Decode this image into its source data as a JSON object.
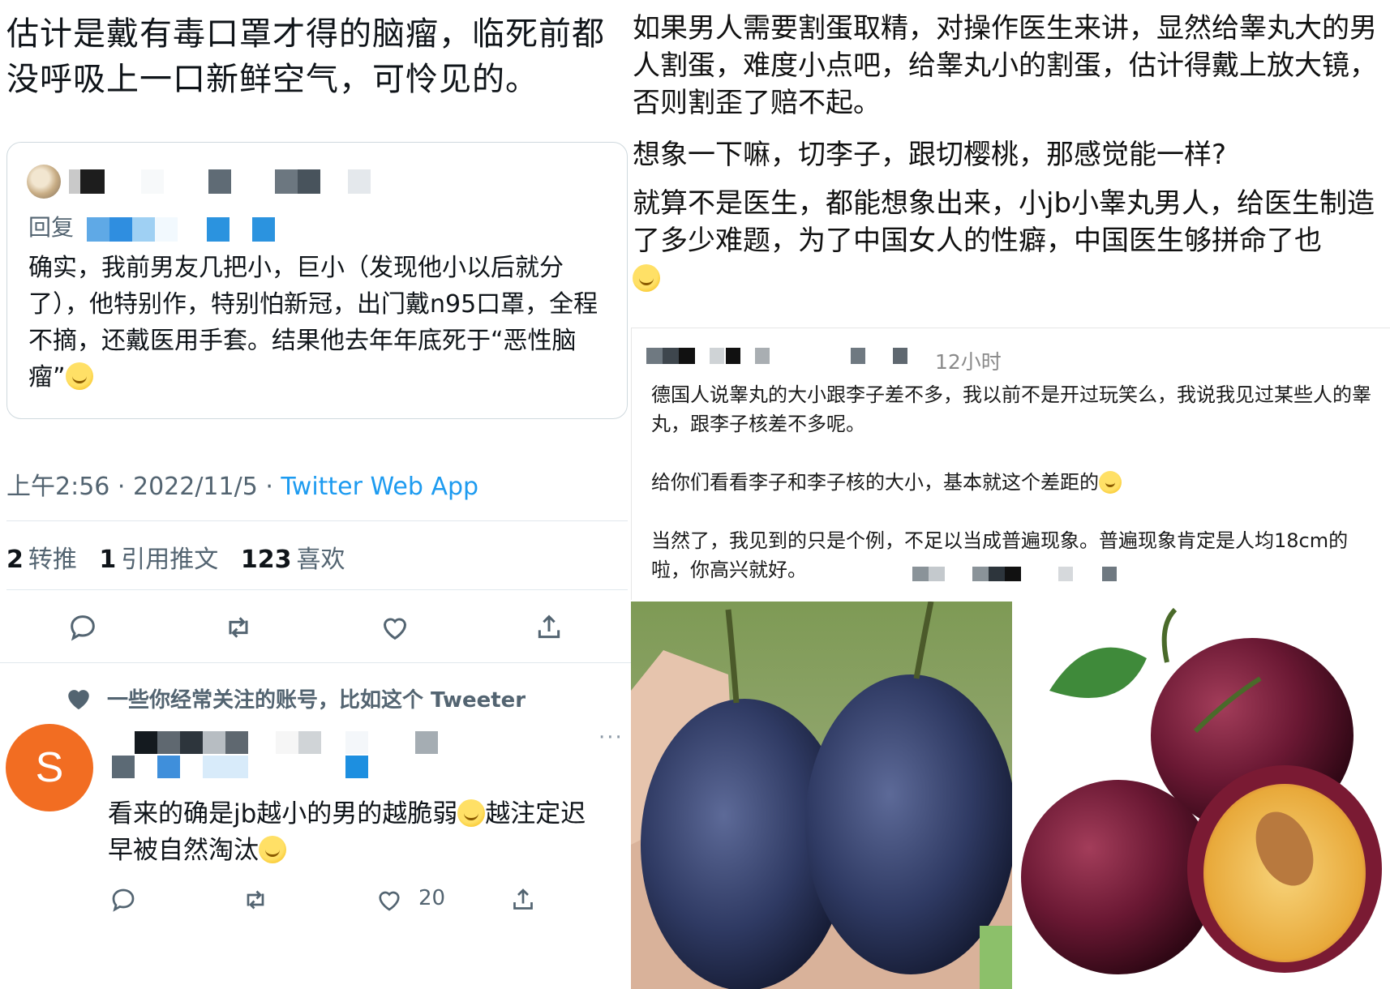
{
  "tweet": {
    "text": "估计是戴有毒口罩才得的脑瘤，临死前都没呼吸上一口新鲜空气，可怜见的。",
    "quoted": {
      "reply_label": "回复",
      "body": "确实，我前男友几把小，巨小（发现他小以后就分了），他特别作，特别怕新冠，出门戴n95口罩，全程不摘，还戴医用手套。结果他去年年底死于“恶性脑瘤”"
    },
    "timestamp": "上午2:56 · 2022/11/5 · ",
    "source_app": "Twitter Web App",
    "stats": {
      "retweets_count": "2",
      "retweets_label": "转推",
      "quotes_count": "1",
      "quotes_label": "引用推文",
      "likes_count": "123",
      "likes_label": "喜欢"
    }
  },
  "recommendation": {
    "label": "一些你经常关注的账号，比如这个 Tweeter",
    "avatar_letter": "S",
    "more": "···",
    "reply_text_1": "看来的确是jb越小的男的越脆弱",
    "reply_text_2": "越注定迟早被自然淘汰",
    "like_count": "20"
  },
  "right": {
    "para1": "如果男人需要割蛋取精，对操作医生来讲，显然给睾丸大的男人割蛋，难度小点吧，给睾丸小的割蛋，估计得戴上放大镜，否则割歪了赔不起。",
    "para2": "想象一下嘛，切李子，跟切樱桃，那感觉能一样?",
    "para3": "就算不是医生，都能想象出来，小jb小睾丸男人，给医生制造了多少难题，为了中国女人的性癖，中国医生够拼命了也",
    "weibo": {
      "time": "12小时",
      "p1": "德国人说睾丸的大小跟李子差不多，我以前不是开过玩笑么，我说我见过某些人的睾丸，跟李子核差不多呢。",
      "p2": "给你们看看李子和李子核的大小，基本就这个差距的",
      "p3": "当然了，我见到的只是个例，不足以当成普遍现象。普遍现象肯定是人均18cm的啦，你高兴就好。"
    }
  },
  "colors": {
    "twitter_blue": "#1d9bf0",
    "secondary_text": "#536471",
    "avatar_orange": "#f26d22"
  },
  "icons": [
    "reply-icon",
    "retweet-icon",
    "like-icon",
    "share-icon",
    "heart-icon",
    "laugh-cry-emoji",
    "smile-emoji",
    "rofl-emoji"
  ]
}
